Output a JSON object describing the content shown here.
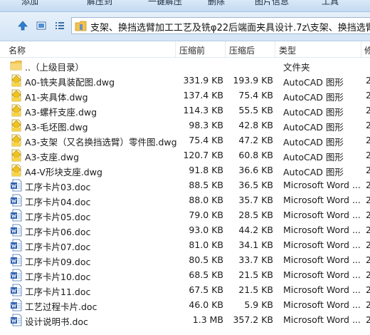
{
  "toolbar": {
    "items": [
      "添加",
      "解压到",
      "一键解压",
      "删除",
      "图片信息",
      "工具"
    ]
  },
  "address": {
    "path": "支架、换挡选臂加工工艺及铣φ22后端面夹具设计.7z\\支架、换挡选臂加工工"
  },
  "columns": {
    "name": "名称",
    "original": "压缩前",
    "compressed": "压缩后",
    "type": "类型",
    "more": "修"
  },
  "files": [
    {
      "name": "..（上级目录）",
      "original": "",
      "compressed": "",
      "type": "文件夹",
      "icon": "folder-icon",
      "more": ""
    },
    {
      "name": "A0-铣夹具装配图.dwg",
      "original": "331.9 KB",
      "compressed": "193.9 KB",
      "type": "AutoCAD 图形",
      "icon": "dwg-icon",
      "more": "2"
    },
    {
      "name": "A1-夹具体.dwg",
      "original": "137.4 KB",
      "compressed": "75.4 KB",
      "type": "AutoCAD 图形",
      "icon": "dwg-icon",
      "more": "2"
    },
    {
      "name": "A3-螺杆支座.dwg",
      "original": "114.3 KB",
      "compressed": "55.5 KB",
      "type": "AutoCAD 图形",
      "icon": "dwg-icon",
      "more": "2"
    },
    {
      "name": "A3-毛坯图.dwg",
      "original": "98.3 KB",
      "compressed": "42.8 KB",
      "type": "AutoCAD 图形",
      "icon": "dwg-icon",
      "more": "2"
    },
    {
      "name": "A3-支架（又名换挡选臂）零件图.dwg",
      "original": "75.4 KB",
      "compressed": "47.2 KB",
      "type": "AutoCAD 图形",
      "icon": "dwg-icon",
      "more": "2"
    },
    {
      "name": "A3-支座.dwg",
      "original": "120.7 KB",
      "compressed": "60.8 KB",
      "type": "AutoCAD 图形",
      "icon": "dwg-icon",
      "more": "2"
    },
    {
      "name": "A4-V形块支座.dwg",
      "original": "91.8 KB",
      "compressed": "36.6 KB",
      "type": "AutoCAD 图形",
      "icon": "dwg-icon",
      "more": "2"
    },
    {
      "name": "工序卡片03.doc",
      "original": "88.5 KB",
      "compressed": "36.5 KB",
      "type": "Microsoft Word ...",
      "icon": "word-doc-icon",
      "more": "2"
    },
    {
      "name": "工序卡片04.doc",
      "original": "88.0 KB",
      "compressed": "35.7 KB",
      "type": "Microsoft Word ...",
      "icon": "word-doc-icon",
      "more": "2"
    },
    {
      "name": "工序卡片05.doc",
      "original": "79.0 KB",
      "compressed": "28.5 KB",
      "type": "Microsoft Word ...",
      "icon": "word-doc-icon",
      "more": "2"
    },
    {
      "name": "工序卡片06.doc",
      "original": "93.0 KB",
      "compressed": "44.2 KB",
      "type": "Microsoft Word ...",
      "icon": "word-doc-icon",
      "more": "2"
    },
    {
      "name": "工序卡片07.doc",
      "original": "81.0 KB",
      "compressed": "34.1 KB",
      "type": "Microsoft Word ...",
      "icon": "word-doc-icon",
      "more": "2"
    },
    {
      "name": "工序卡片09.doc",
      "original": "80.5 KB",
      "compressed": "33.7 KB",
      "type": "Microsoft Word ...",
      "icon": "word-doc-icon",
      "more": "2"
    },
    {
      "name": "工序卡片10.doc",
      "original": "68.5 KB",
      "compressed": "21.5 KB",
      "type": "Microsoft Word ...",
      "icon": "word-doc-icon",
      "more": "2"
    },
    {
      "name": "工序卡片11.doc",
      "original": "67.5 KB",
      "compressed": "21.5 KB",
      "type": "Microsoft Word ...",
      "icon": "word-doc-icon",
      "more": "2"
    },
    {
      "name": "工艺过程卡片.doc",
      "original": "46.0 KB",
      "compressed": "5.9 KB",
      "type": "Microsoft Word ...",
      "icon": "word-doc-icon",
      "more": "2"
    },
    {
      "name": "设计说明书.doc",
      "original": "1.3 MB",
      "compressed": "357.2 KB",
      "type": "Microsoft Word ...",
      "icon": "word-doc-icon",
      "more": "2"
    }
  ]
}
